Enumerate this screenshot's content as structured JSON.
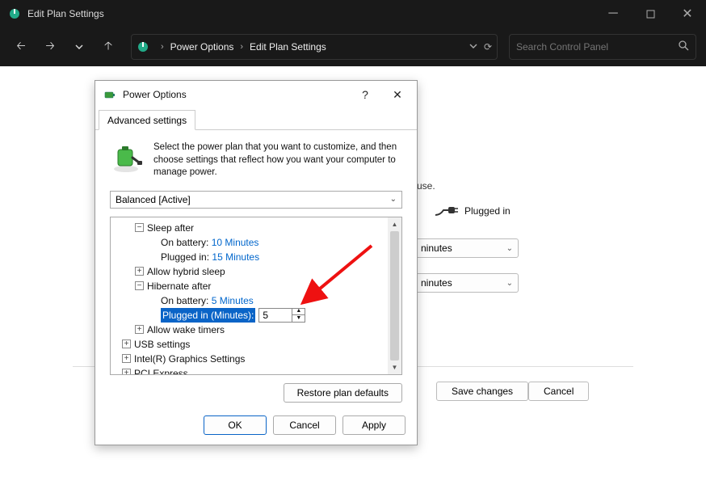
{
  "parent": {
    "title": "Edit Plan Settings",
    "breadcrumb": {
      "item1": "Power Options",
      "item2": "Edit Plan Settings"
    },
    "search_placeholder": "Search Control Panel"
  },
  "bg": {
    "prompt_suffix": "use.",
    "plugged_label": "Plugged in",
    "select1_visible": "ninutes",
    "select2_visible": "ninutes",
    "save_label": "Save changes",
    "cancel_label": "Cancel"
  },
  "dialog": {
    "title": "Power Options",
    "tab_label": "Advanced settings",
    "intro": "Select the power plan that you want to customize, and then choose settings that reflect how you want your computer to manage power.",
    "plan": "Balanced [Active]",
    "restore_label": "Restore plan defaults",
    "ok_label": "OK",
    "cancel_label": "Cancel",
    "apply_label": "Apply"
  },
  "tree": {
    "sleep_after": "Sleep after",
    "sleep_batt_label": "On battery:",
    "sleep_batt_value": "10 Minutes",
    "sleep_plug_label": "Plugged in:",
    "sleep_plug_value": "15 Minutes",
    "hybrid": "Allow hybrid sleep",
    "hibernate": "Hibernate after",
    "hib_batt_label": "On battery:",
    "hib_batt_value": "5 Minutes",
    "hib_plug_label_sel": "Plugged in (Minutes):",
    "hib_plug_value": "5",
    "wake": "Allow wake timers",
    "usb": "USB settings",
    "intel": "Intel(R) Graphics Settings",
    "pci": "PCI Express"
  }
}
